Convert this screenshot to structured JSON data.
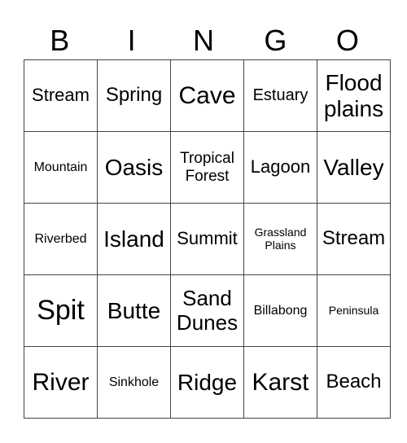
{
  "header": [
    "B",
    "I",
    "N",
    "G",
    "O"
  ],
  "rows": [
    [
      "Stream",
      "Spring",
      "Cave",
      "Estuary",
      "Flood plains"
    ],
    [
      "Mountain",
      "Oasis",
      "Tropical Forest",
      "Lagoon",
      "Valley"
    ],
    [
      "Riverbed",
      "Island",
      "Summit",
      "Grassland Plains",
      "Stream"
    ],
    [
      "Spit",
      "Butte",
      "Sand Dunes",
      "Billabong",
      "Peninsula"
    ],
    [
      "River",
      "Sinkhole",
      "Ridge",
      "Karst",
      "Beach"
    ]
  ]
}
